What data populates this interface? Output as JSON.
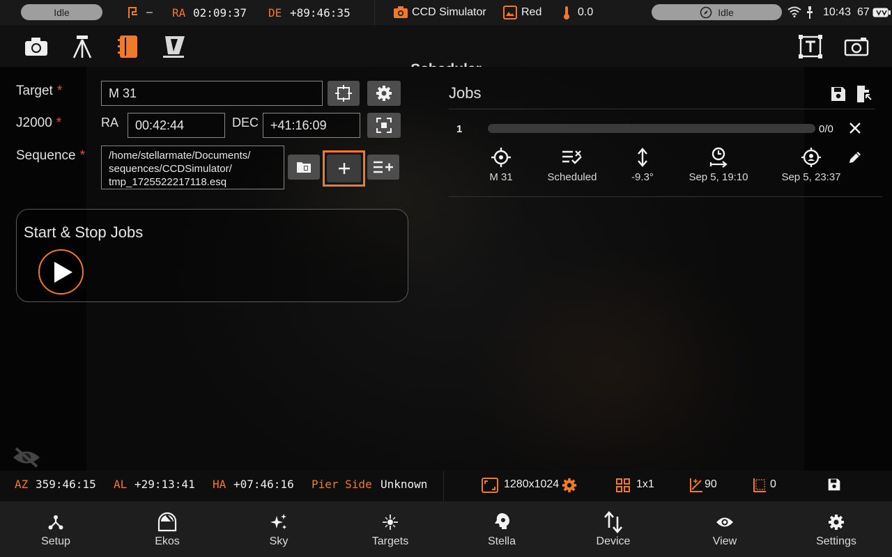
{
  "status_bar": {
    "mount_status": "Idle",
    "park_text": "–",
    "ra_label": "RA",
    "ra_value": "02:09:37",
    "de_label": "DE",
    "de_value": "+89:46:35",
    "camera_name": "CCD Simulator",
    "filter_name": "Red",
    "temperature": "0.0",
    "guide_status": "Idle",
    "time": "10:43",
    "battery": "67"
  },
  "toolbar": {
    "title": "Scheduler"
  },
  "form": {
    "target_label": "Target",
    "target_value": "M 31",
    "j2000_label": "J2000",
    "ra_label": "RA",
    "ra_value": "00:42:44",
    "dec_label": "DEC",
    "dec_value": "+41:16:09",
    "sequence_label": "Sequence",
    "sequence_line1": "/home/stellarmate/Documents/",
    "sequence_line2": "sequences/CCDSimulator/",
    "sequence_line3": "tmp_1725522217118.esq",
    "required_mark": "*"
  },
  "start_stop": {
    "title": "Start & Stop Jobs"
  },
  "jobs": {
    "title": "Jobs",
    "items": [
      {
        "index": "1",
        "progress_text": "0/0",
        "progress_fraction": 0,
        "target": "M 31",
        "state": "Scheduled",
        "altitude": "-9.3°",
        "start_time": "Sep 5, 19:10",
        "end_time": "Sep 5, 23:37"
      }
    ]
  },
  "info_bar": {
    "az_label": "AZ",
    "az_value": "359:46:15",
    "al_label": "AL",
    "al_value": "+29:13:41",
    "ha_label": "HA",
    "ha_value": "+07:46:16",
    "pier_label": "Pier Side",
    "pier_value": "Unknown",
    "resolution": "1280x1024",
    "binning": "1x1",
    "gain": "90",
    "offset": "0"
  },
  "nav": [
    {
      "label": "Setup",
      "icon": "setup-icon"
    },
    {
      "label": "Ekos",
      "icon": "ekos-icon"
    },
    {
      "label": "Sky",
      "icon": "sky-icon"
    },
    {
      "label": "Targets",
      "icon": "targets-icon"
    },
    {
      "label": "Stella",
      "icon": "stella-icon"
    },
    {
      "label": "Device",
      "icon": "device-icon"
    },
    {
      "label": "View",
      "icon": "view-icon"
    },
    {
      "label": "Settings",
      "icon": "settings-icon"
    }
  ],
  "colors": {
    "accent": "#f07a2a",
    "required": "#e74c3c",
    "status_pill": "#9e9e9e"
  }
}
